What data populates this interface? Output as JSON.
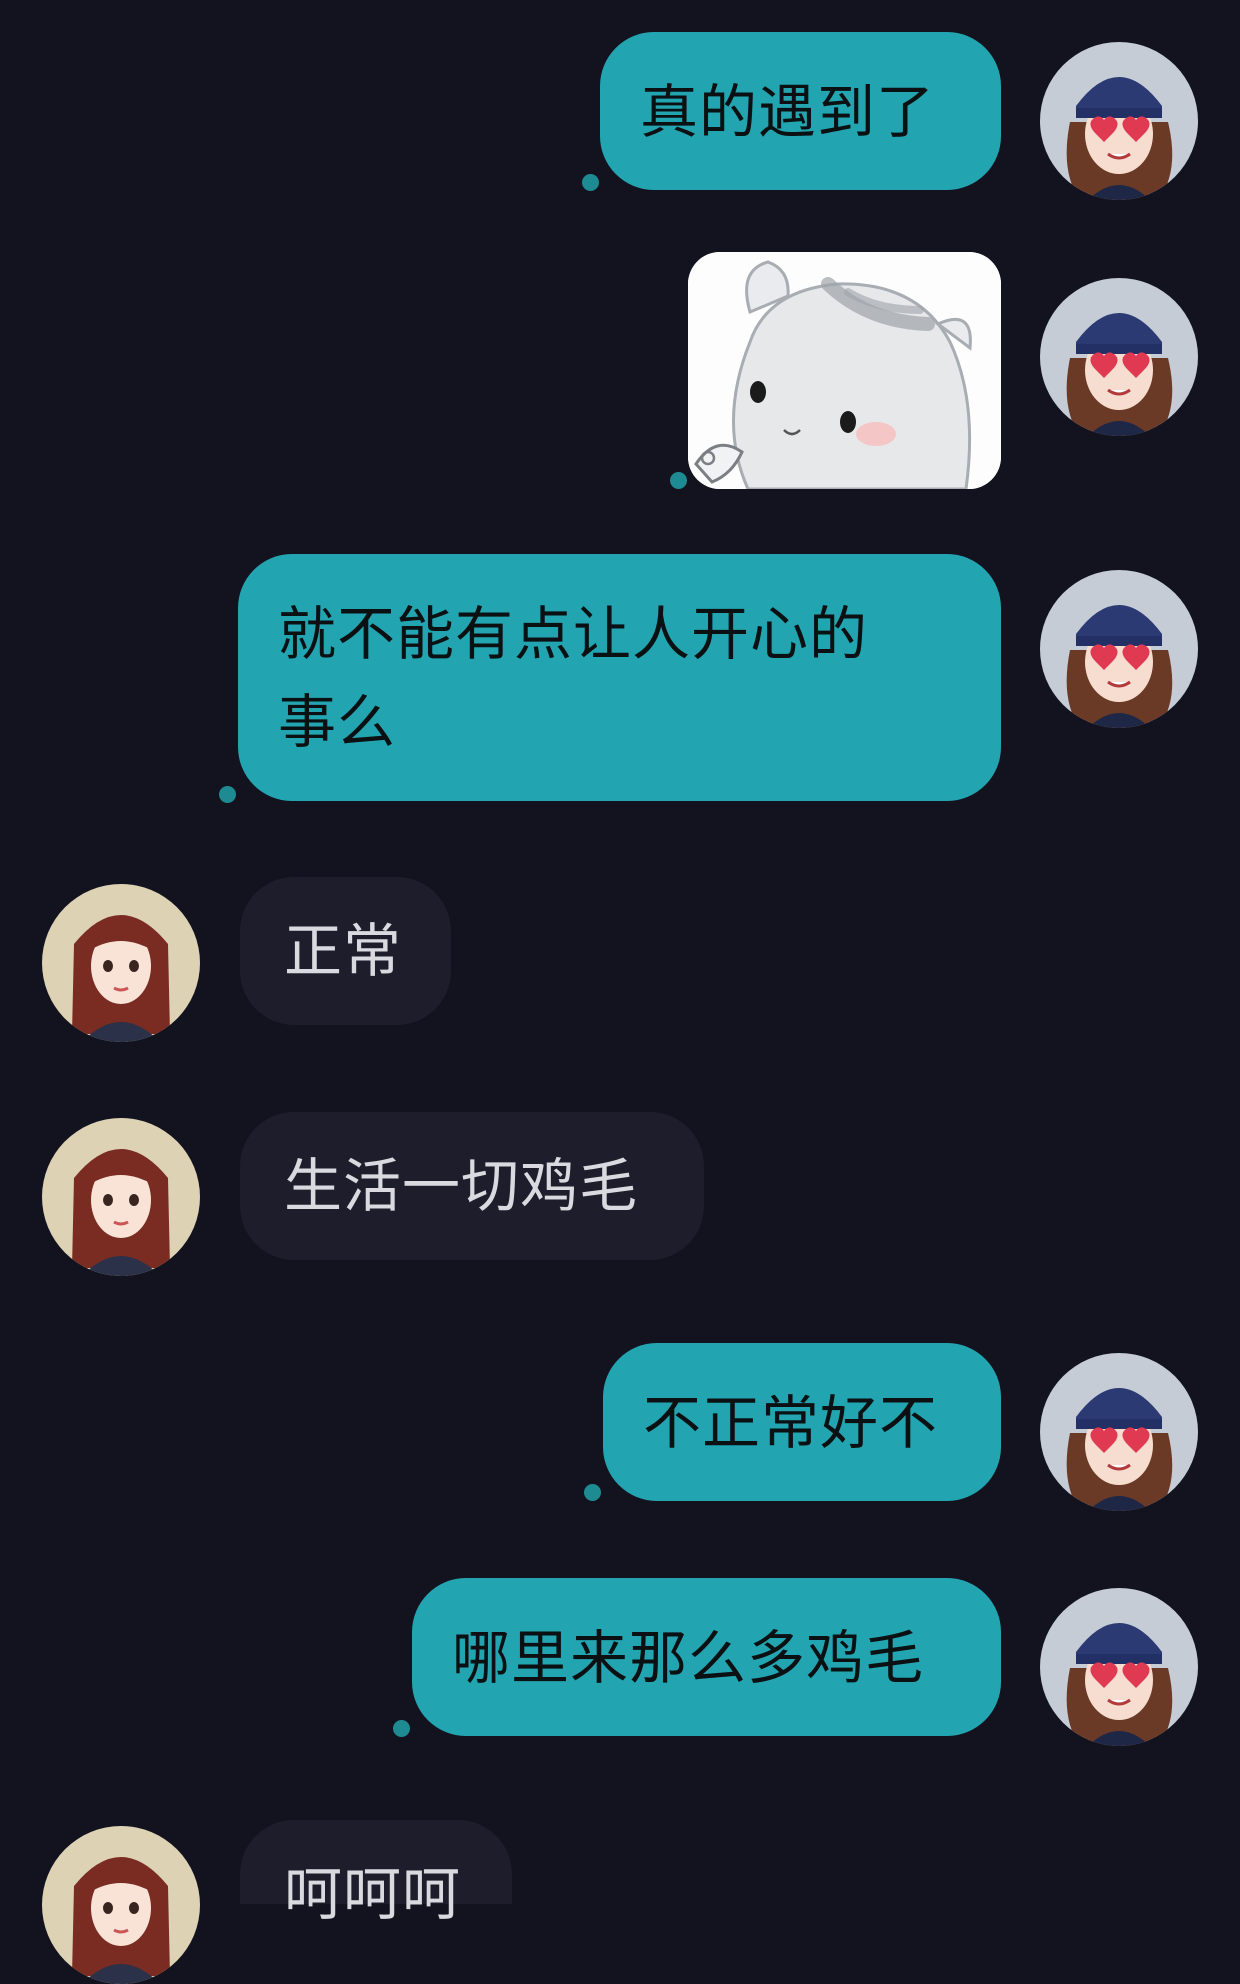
{
  "messages": [
    {
      "sender": "me",
      "type": "text",
      "text": "真的遇到了"
    },
    {
      "sender": "me",
      "type": "image",
      "sticker": "hamster-sticker"
    },
    {
      "sender": "me",
      "type": "text",
      "text": "就不能有点让人开心的\n事么"
    },
    {
      "sender": "them",
      "type": "text",
      "text": "正常"
    },
    {
      "sender": "them",
      "type": "text",
      "text": "生活一切鸡毛"
    },
    {
      "sender": "me",
      "type": "text",
      "text": "不正常好不"
    },
    {
      "sender": "me",
      "type": "text",
      "text": "哪里来那么多鸡毛"
    },
    {
      "sender": "them",
      "type": "text",
      "text": "呵呵呵"
    }
  ],
  "colors": {
    "background": "#13131f",
    "outgoing_bubble": "#23a5b1",
    "incoming_bubble": "#1d1d2b",
    "read_dot": "#1e8a92"
  }
}
